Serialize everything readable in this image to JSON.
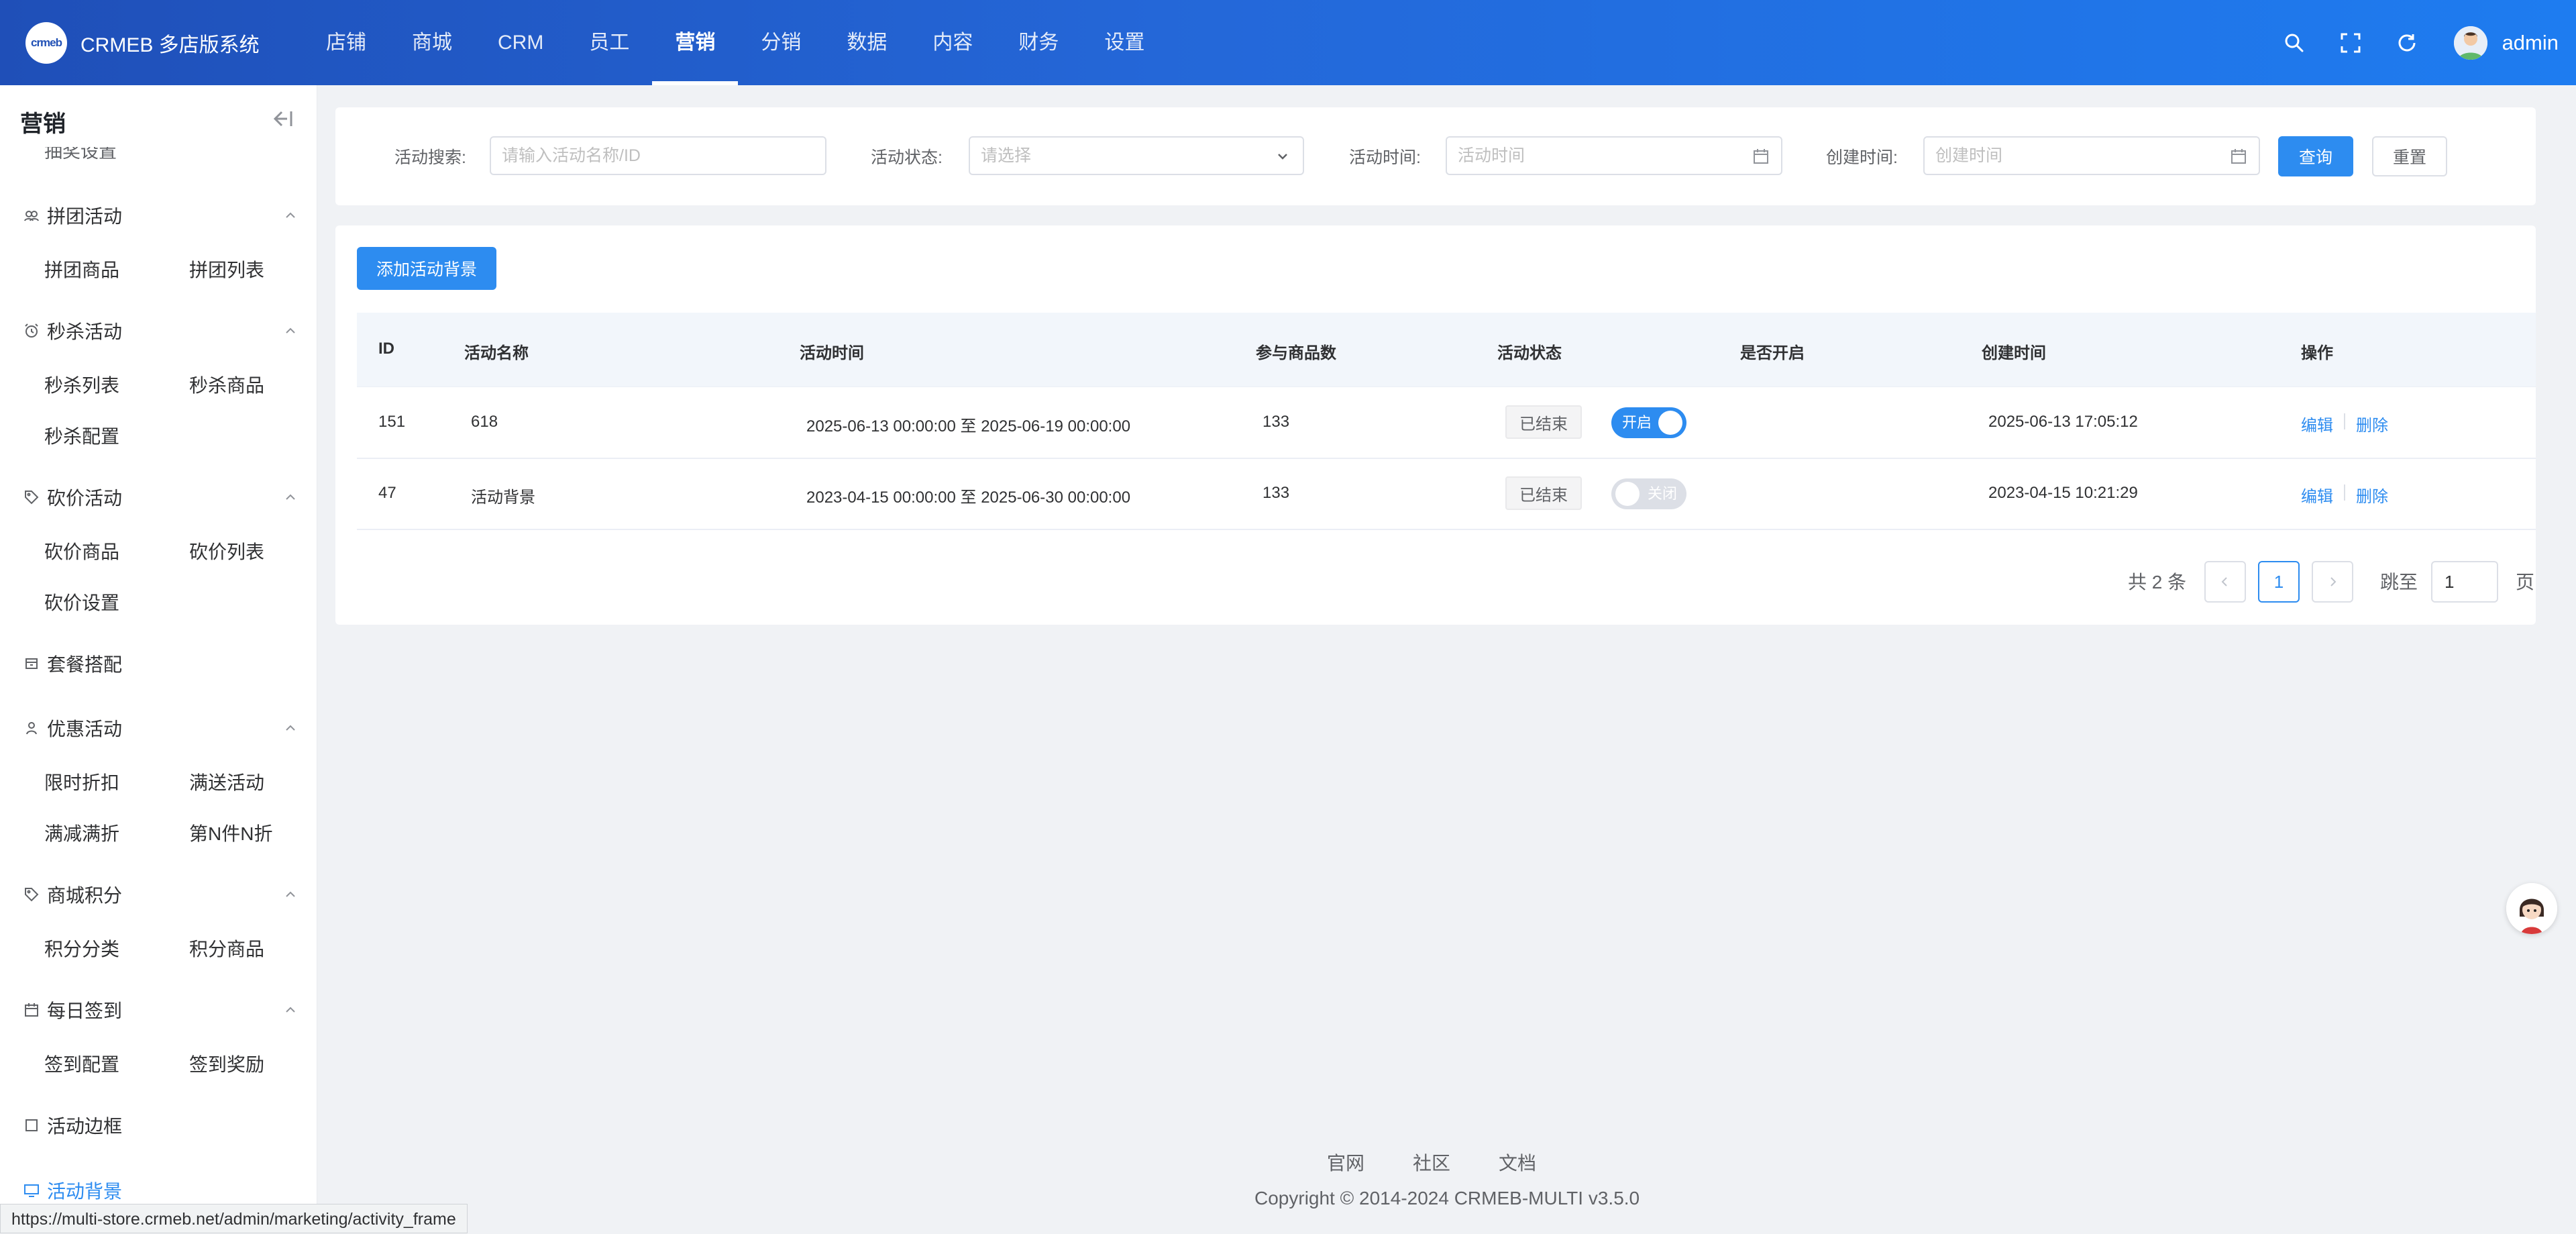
{
  "header": {
    "logo_text": "crmeb",
    "system_name": "CRMEB 多店版系统",
    "nav": [
      "店铺",
      "商城",
      "CRM",
      "员工",
      "营销",
      "分销",
      "数据",
      "内容",
      "财务",
      "设置"
    ],
    "active_nav": "营销",
    "user": "admin",
    "accent": "#2d8cf0",
    "icons": [
      "search-icon",
      "fullscreen-icon",
      "refresh-icon",
      "avatar"
    ]
  },
  "sidebar": {
    "title": "营销",
    "clipped_item": "抽奖设置",
    "groups": [
      {
        "name": "拼团活动",
        "items": [
          "拼团商品",
          "拼团列表"
        ]
      },
      {
        "name": "秒杀活动",
        "items": [
          "秒杀列表",
          "秒杀商品",
          "秒杀配置"
        ]
      },
      {
        "name": "砍价活动",
        "items": [
          "砍价商品",
          "砍价列表",
          "砍价设置"
        ]
      },
      {
        "name": "套餐搭配",
        "items": []
      },
      {
        "name": "优惠活动",
        "items": [
          "限时折扣",
          "满送活动",
          "满减满折",
          "第N件N折"
        ]
      },
      {
        "name": "商城积分",
        "items": [
          "积分分类",
          "积分商品"
        ]
      },
      {
        "name": "每日签到",
        "items": [
          "签到配置",
          "签到奖励"
        ]
      },
      {
        "name": "活动边框",
        "items": []
      },
      {
        "name": "活动背景",
        "items": []
      }
    ],
    "active": "活动背景"
  },
  "filters": {
    "search_label": "活动搜索:",
    "search_placeholder": "请输入活动名称/ID",
    "status_label": "活动状态:",
    "status_placeholder": "请选择",
    "time_label": "活动时间:",
    "time_placeholder": "活动时间",
    "created_label": "创建时间:",
    "created_placeholder": "创建时间",
    "query_button": "查询",
    "reset_button": "重置"
  },
  "add_button": "添加活动背景",
  "table": {
    "columns": [
      "ID",
      "活动名称",
      "活动时间",
      "参与商品数",
      "活动状态",
      "是否开启",
      "创建时间",
      "操作"
    ],
    "rows": [
      {
        "id": "151",
        "name": "618",
        "time": "2025-06-13 00:00:00 至 2025-06-19 00:00:00",
        "count": "133",
        "status": "已结束",
        "enabled": true,
        "switch_text": "开启",
        "created": "2025-06-13 17:05:12",
        "edit": "编辑",
        "delete": "删除"
      },
      {
        "id": "47",
        "name": "活动背景",
        "time": "2023-04-15 00:00:00 至 2025-06-30 00:00:00",
        "count": "133",
        "status": "已结束",
        "enabled": false,
        "switch_text": "关闭",
        "created": "2023-04-15 10:21:29",
        "edit": "编辑",
        "delete": "删除"
      }
    ]
  },
  "pagination": {
    "total_text": "共 2 条",
    "current_page": "1",
    "jump_label": "跳至",
    "jump_value": "1",
    "page_suffix": "页"
  },
  "footer": {
    "links": [
      "官网",
      "社区",
      "文档"
    ],
    "copyright": "Copyright © 2014-2024 CRMEB-MULTI v3.5.0"
  },
  "status_bar_url": "https://multi-store.crmeb.net/admin/marketing/activity_frame"
}
